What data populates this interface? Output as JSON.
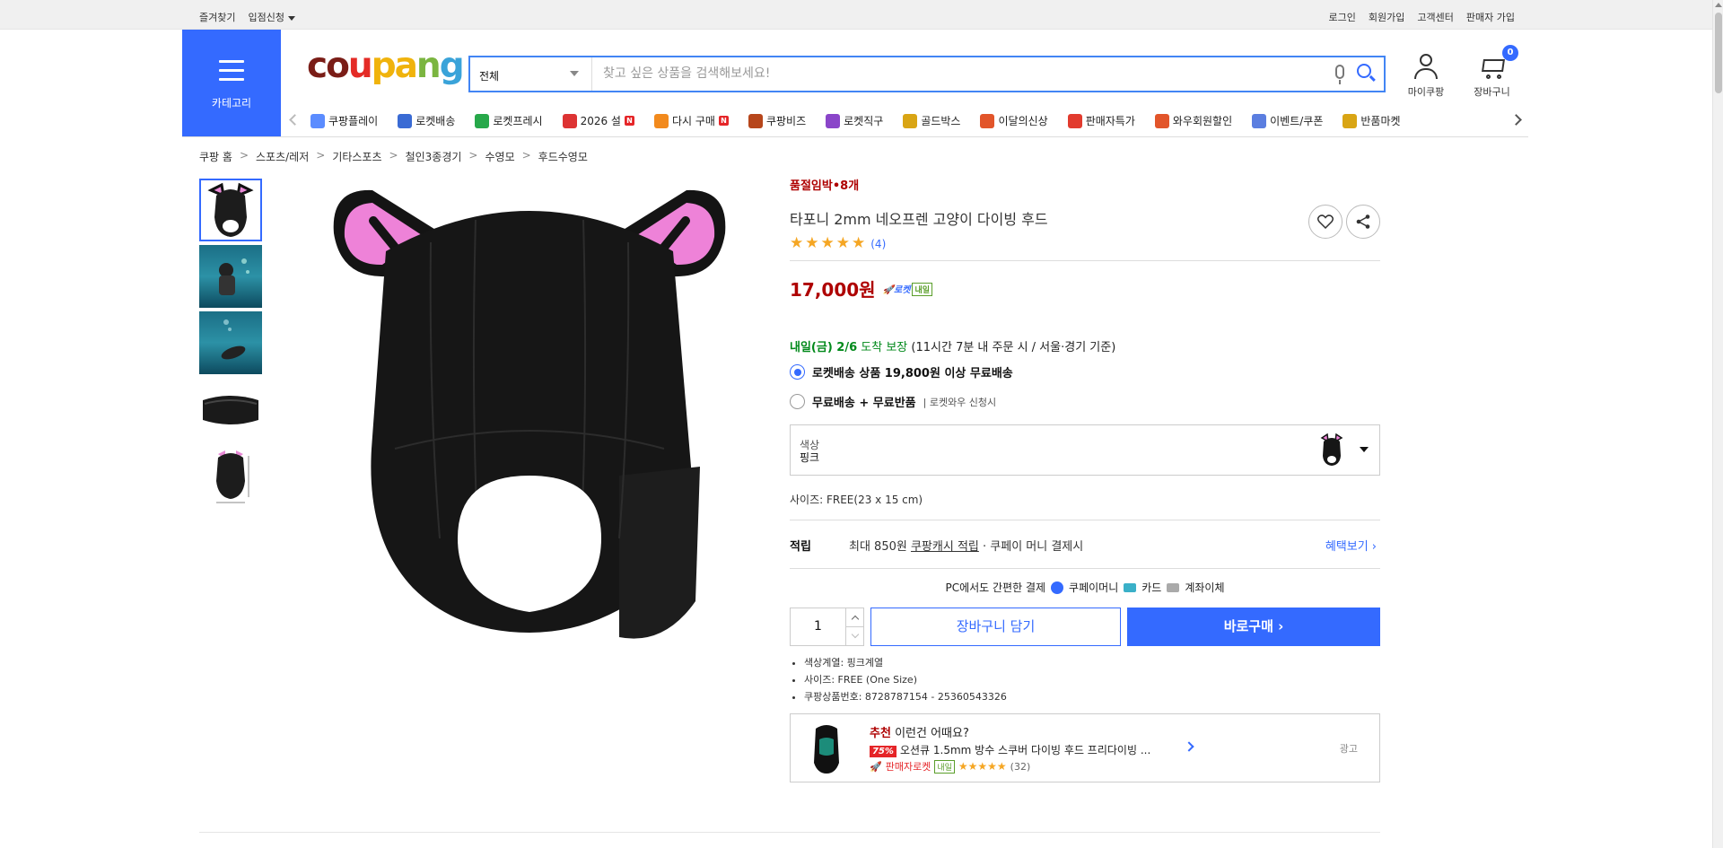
{
  "topbar": {
    "favorites": "즐겨찾기",
    "store_apply": "입점신청",
    "login": "로그인",
    "signup": "회원가입",
    "customer_center": "고객센터",
    "seller_signup": "판매자 가입"
  },
  "header": {
    "category_label": "카테고리",
    "logo": {
      "p1": "co",
      "p2": "u",
      "p3": "pa",
      "p4": "n",
      "p5": "g"
    },
    "search": {
      "category": "전체",
      "placeholder": "찾고 싶은 상품을 검색해보세요!"
    },
    "mycoupang": "마이쿠팡",
    "cart": "장바구니",
    "cart_count": "0"
  },
  "catnav": [
    {
      "label": "쿠팡플레이",
      "icon": "play-icon",
      "color": "#5b8cff",
      "n": false
    },
    {
      "label": "로켓배송",
      "icon": "rocket-icon",
      "color": "#3a6bd4",
      "n": false
    },
    {
      "label": "로켓프레시",
      "icon": "rocket-fresh-icon",
      "color": "#27a84a",
      "n": false
    },
    {
      "label": "2026 설",
      "icon": "gift-icon",
      "color": "#d33",
      "n": true
    },
    {
      "label": "다시 구매",
      "icon": "home-icon",
      "color": "#f28a1d",
      "n": true
    },
    {
      "label": "쿠팡비즈",
      "icon": "biz-icon",
      "color": "#b7461b",
      "n": false
    },
    {
      "label": "로켓직구",
      "icon": "global-icon",
      "color": "#8a45c9",
      "n": false
    },
    {
      "label": "골드박스",
      "icon": "goldbox-icon",
      "color": "#d9a514",
      "n": false
    },
    {
      "label": "이달의신상",
      "icon": "new-icon",
      "color": "#e2552a",
      "n": false
    },
    {
      "label": "판매자특가",
      "icon": "sale-icon",
      "color": "#e23b2e",
      "n": false
    },
    {
      "label": "와우회원할인",
      "icon": "wow-icon",
      "color": "#e2552a",
      "n": false
    },
    {
      "label": "이벤트/쿠폰",
      "icon": "coupon-icon",
      "color": "#5b7ee0",
      "n": false
    },
    {
      "label": "반품마켓",
      "icon": "market-icon",
      "color": "#d9a514",
      "n": false
    }
  ],
  "breadcrumb": [
    "쿠팡 홈",
    "스포츠/레저",
    "기타스포츠",
    "철인3종경기",
    "수영모",
    "후드수영모"
  ],
  "product": {
    "urgency": "품절임박•8개",
    "title": "타포니 2mm 네오프렌 고양이 다이빙 후드",
    "review_count": "(4)",
    "price": "17,000원",
    "rocket": "로켓",
    "rocket_tag": "내일",
    "delivery_date": "내일(금) 2/6",
    "delivery_guarantee": "도착 보장",
    "delivery_cond": "(11시간 7분 내 주문 시 / 서울·경기 기준)",
    "ship_opt1": "로켓배송 상품 19,800원 이상 무료배송",
    "ship_opt2": "무료배송 + 무료반품",
    "ship_opt2_sub": "| 로켓와우 신청시",
    "option_label": "색상",
    "option_value": "핑크",
    "size_text": "사이즈: FREE(23 x 15 cm)",
    "accum_key": "적립",
    "accum_text1": "최대 850원",
    "accum_link": "쿠팡캐시 적립",
    "accum_text2": "· 쿠페이 머니 결제시",
    "accum_more": "혜택보기",
    "pay_text": "PC에서도 간편한 결제",
    "pay_money": "쿠페이머니",
    "pay_card": "카드",
    "pay_bank": "계좌이체",
    "qty": "1",
    "add_cart": "장바구니 담기",
    "buy_now": "바로구매",
    "specs": [
      "색상계열: 핑크계열",
      "사이즈: FREE (One Size)",
      "쿠팡상품번호: 8728787154 - 25360543326"
    ]
  },
  "recommend": {
    "head_red": "추천",
    "head_rest": "이런건 어때요?",
    "discount": "75%",
    "name": "오션큐 1.5mm 방수 스쿠버 다이빙 후드 프리다이빙 ...",
    "seller_rocket": "판매자로켓",
    "tag": "내일",
    "stars": "★★★★★",
    "count": "(32)",
    "ad": "광고"
  },
  "colors": {
    "accent": "#346aff",
    "price": "#ae0000",
    "green": "#00891a"
  }
}
